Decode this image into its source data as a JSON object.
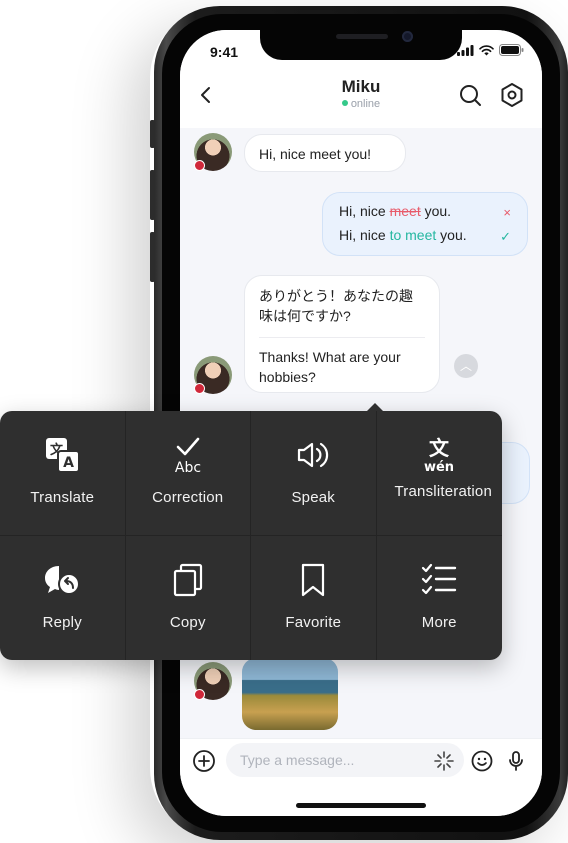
{
  "status_bar": {
    "time": "9:41"
  },
  "header": {
    "contact_name": "Miku",
    "contact_status": "online"
  },
  "messages": [
    {
      "from": "contact",
      "text": "Hi, nice meet you!"
    },
    {
      "from": "me",
      "correction": {
        "original": {
          "prefix": "Hi, nice ",
          "error": "meet",
          "suffix": " you.",
          "mark": "×"
        },
        "corrected": {
          "prefix": "Hi, nice ",
          "fix": "to meet",
          "suffix": " you.",
          "mark": "✓"
        }
      }
    },
    {
      "from": "contact",
      "text": "ありがとう！あなたの趣味は何ですか?",
      "translation": "Thanks! What are your hobbies?"
    }
  ],
  "context_menu": {
    "items": [
      {
        "label": "Translate",
        "icon": "translate-icon"
      },
      {
        "label": "Correction",
        "icon": "correction-icon"
      },
      {
        "label": "Speak",
        "icon": "speaker-icon"
      },
      {
        "label": "Transliteration",
        "icon": "transliteration-icon",
        "icon_glyph": "文",
        "icon_sub": "wén"
      },
      {
        "label": "Reply",
        "icon": "reply-icon"
      },
      {
        "label": "Copy",
        "icon": "copy-icon"
      },
      {
        "label": "Favorite",
        "icon": "bookmark-icon"
      },
      {
        "label": "More",
        "icon": "checklist-icon"
      }
    ]
  },
  "input_bar": {
    "placeholder": "Type a message..."
  },
  "colors": {
    "accent_green": "#25b7a0",
    "error_red": "#e85b6a",
    "online_green": "#35c98a",
    "menu_bg": "#2f2f2f",
    "my_bubble": "#eaf2fd"
  }
}
